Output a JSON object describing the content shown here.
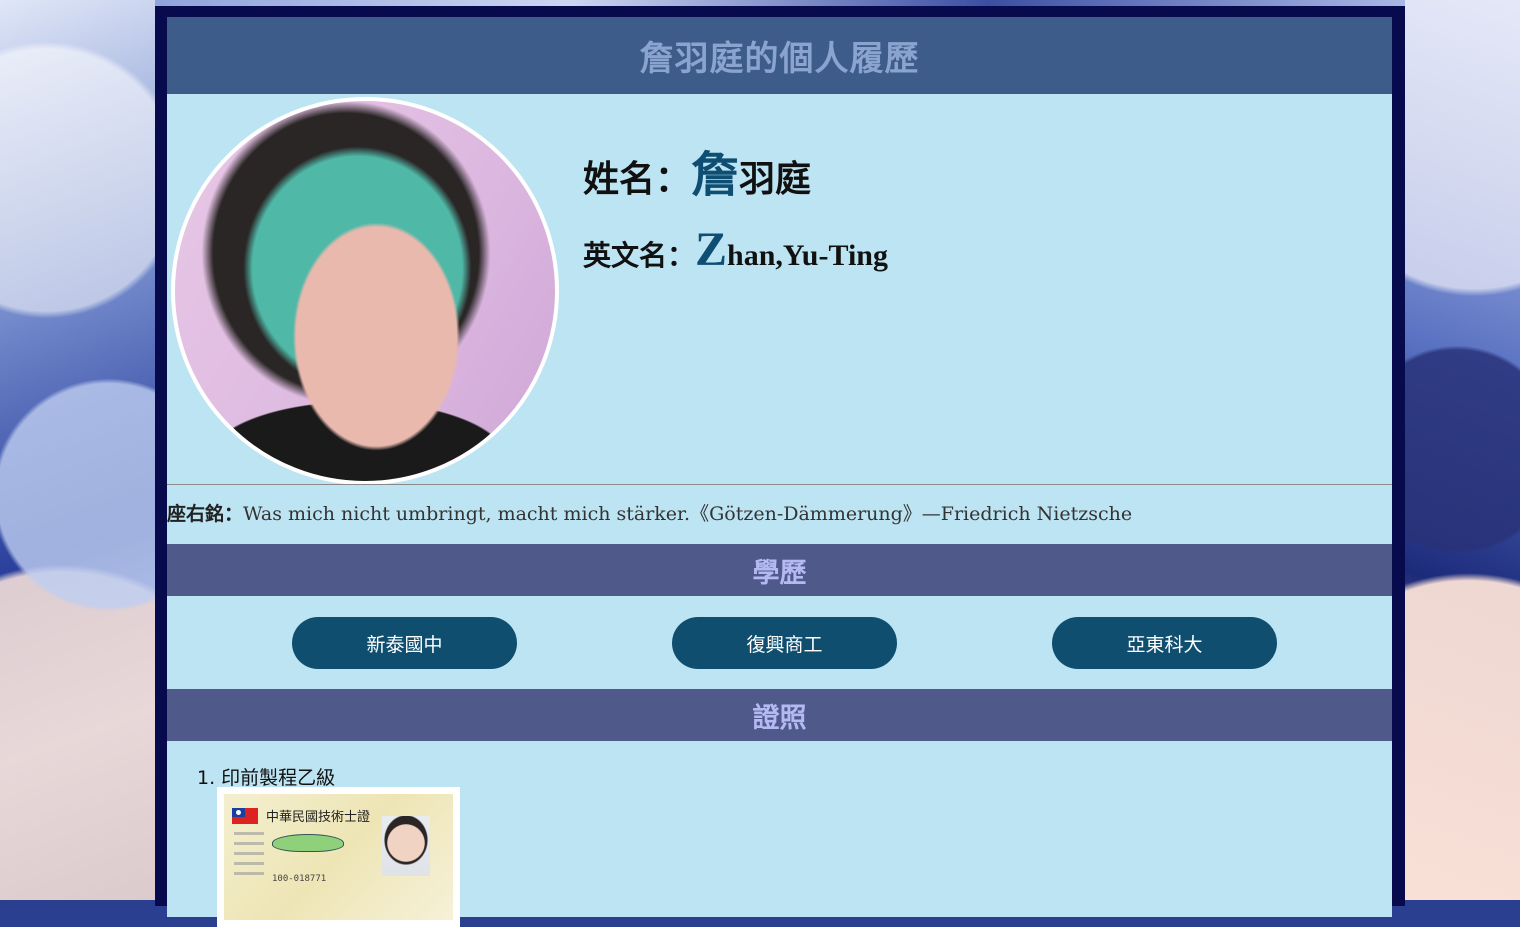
{
  "header": {
    "title": "詹羽庭的個人履歷"
  },
  "profile": {
    "name_label": "姓名：",
    "name_first_char": "詹",
    "name_rest": "羽庭",
    "english_label": "英文名：",
    "english_first_char": "Z",
    "english_rest": "han,Yu-Ting",
    "photo": "profile-photo"
  },
  "motto": {
    "label": "座右銘：",
    "text": "Was mich nicht umbringt, macht mich stärker.《Götzen-Dämmerung》—Friedrich Nietzsche"
  },
  "education": {
    "title": "學歷",
    "schools": [
      "新泰國中",
      "復興商工",
      "亞東科大"
    ]
  },
  "certificates": {
    "title": "證照",
    "items": [
      {
        "number": "1.",
        "name": "印前製程乙級",
        "card_title": "中華民國技術士證",
        "card_number": "100-018771"
      }
    ]
  },
  "colors": {
    "frame": "#080a4e",
    "page_bg": "#bde4f2",
    "title_bar": "#3d5c8a",
    "title_text": "#8aa3cf",
    "section_bar": "#4f5a8a",
    "section_text": "#b5b9f3",
    "pill": "#0f4e6f",
    "accent_char": "#0f4e73"
  }
}
